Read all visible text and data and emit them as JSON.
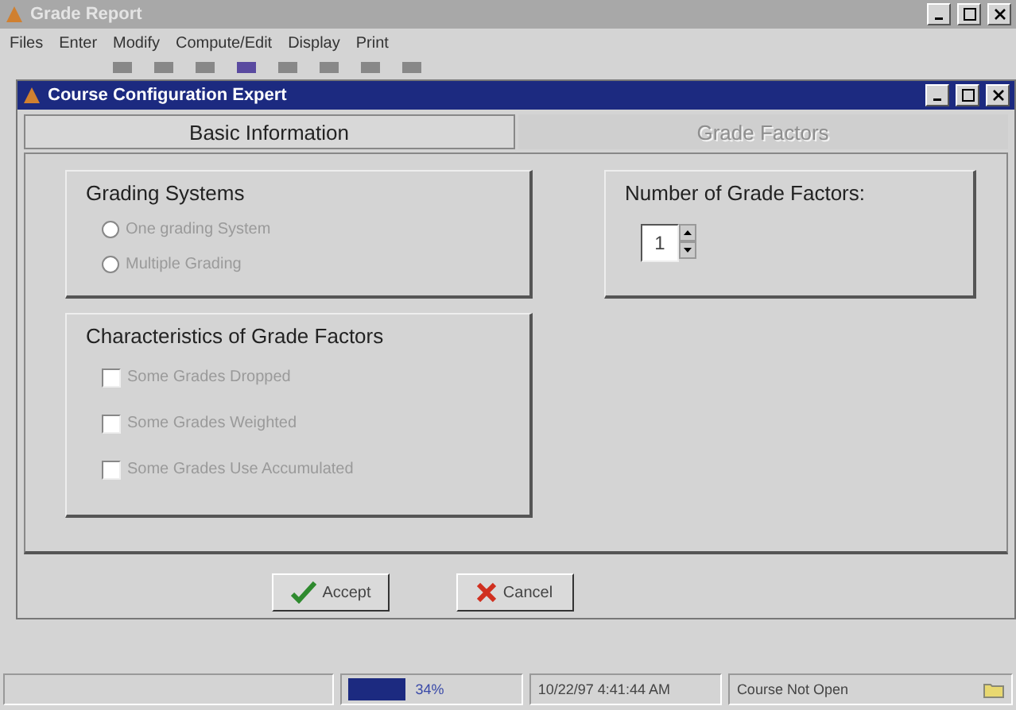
{
  "window": {
    "title": "Grade Report"
  },
  "menu": [
    "Files",
    "Enter",
    "Modify",
    "Compute/Edit",
    "Display",
    "Print"
  ],
  "dialog": {
    "title": "Course Configuration Expert",
    "tabs": [
      {
        "label": "Basic Information",
        "selected": true,
        "disabled": false
      },
      {
        "label": "Grade Factors",
        "selected": false,
        "disabled": true
      }
    ],
    "grading_systems": {
      "title": "Grading Systems",
      "options": [
        {
          "label": "One grading System",
          "selected": false,
          "disabled": true
        },
        {
          "label": "Multiple Grading",
          "selected": false,
          "disabled": true
        }
      ]
    },
    "characteristics": {
      "title": "Characteristics of Grade Factors",
      "options": [
        {
          "label": "Some Grades Dropped",
          "checked": false,
          "disabled": true
        },
        {
          "label": "Some Grades Weighted",
          "checked": false,
          "disabled": true
        },
        {
          "label": "Some Grades Use Accumulated",
          "checked": false,
          "disabled": true
        }
      ]
    },
    "grade_factors": {
      "title": "Number of Grade Factors:",
      "value": "1"
    },
    "buttons": [
      {
        "kind": "accept",
        "label": "Accept"
      },
      {
        "kind": "cancel",
        "label": "Cancel"
      }
    ]
  },
  "status_bar": {
    "progress": {
      "level": 0.34,
      "reading": "34%"
    },
    "datetime": "10/22/97 4:41:44 AM",
    "course": "Course Not Open"
  }
}
